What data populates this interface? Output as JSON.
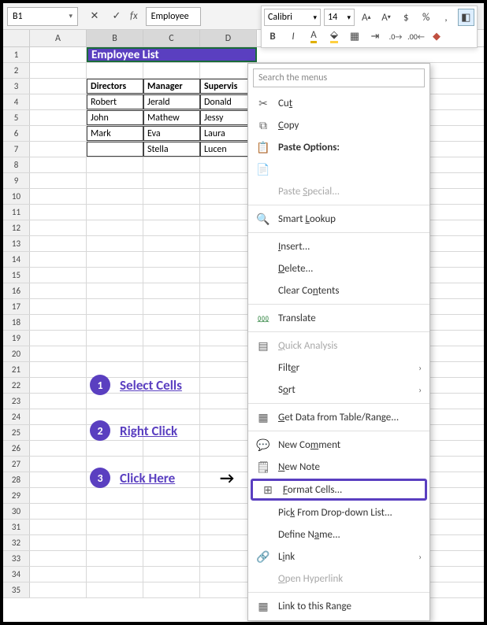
{
  "namebox": "B1",
  "formula_value": "Employee",
  "minitoolbar": {
    "font_name": "Calibri",
    "font_size": "14"
  },
  "columns": [
    "A",
    "B",
    "C",
    "D"
  ],
  "title_cell": "Employee List",
  "table": {
    "headers": [
      "Directors",
      "Manager",
      "Supervis"
    ],
    "rows": [
      [
        "Robert",
        "Jerald",
        "Donald"
      ],
      [
        "John",
        "Mathew",
        "Jessy"
      ],
      [
        "Mark",
        "Eva",
        "Laura"
      ],
      [
        "",
        "Stella",
        "Lucen"
      ]
    ]
  },
  "row_numbers": [
    "1",
    "2",
    "3",
    "4",
    "5",
    "6",
    "7",
    "8",
    "9",
    "10",
    "11",
    "12",
    "13",
    "14",
    "15",
    "16",
    "17",
    "18",
    "19",
    "20",
    "21",
    "22",
    "23",
    "24",
    "25",
    "26",
    "27",
    "28",
    "29",
    "30",
    "31",
    "32",
    "33",
    "34",
    "35"
  ],
  "ctx": {
    "search_placeholder": "Search the menus",
    "cut": "Cut",
    "copy": "Copy",
    "paste_options": "Paste Options:",
    "paste_special": "Paste Special...",
    "smart_lookup": "Smart Lookup",
    "insert": "Insert...",
    "delete": "Delete...",
    "clear": "Clear Contents",
    "translate": "Translate",
    "quick_analysis": "Quick Analysis",
    "filter": "Filter",
    "sort": "Sort",
    "get_data": "Get Data from Table/Range...",
    "new_comment": "New Comment",
    "new_note": "New Note",
    "format_cells": "Format Cells...",
    "pick_list": "Pick From Drop-down List...",
    "define_name": "Define Name...",
    "link": "Link",
    "open_hyperlink": "Open Hyperlink",
    "link_range": "Link to this Range"
  },
  "annotations": {
    "step1": "Select Cells",
    "step2": "Right Click",
    "step3": "Click Here"
  }
}
